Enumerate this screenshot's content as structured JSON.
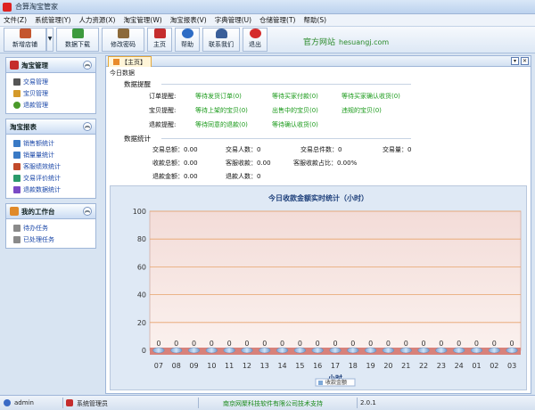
{
  "window": {
    "title": "合算淘宝管家"
  },
  "menu": [
    "文件(Z)",
    "系统管理(Y)",
    "人力资源(X)",
    "淘宝管理(W)",
    "淘宝报表(V)",
    "字典管理(U)",
    "仓储管理(T)",
    "帮助(S)"
  ],
  "toolbar": {
    "buttons": [
      {
        "label": "新增店铺",
        "icon": "store-add-icon",
        "color": "#c4562e"
      },
      {
        "label": "数据下载",
        "icon": "download-icon",
        "color": "#3d9a3d"
      },
      {
        "label": "修改密码",
        "icon": "key-icon",
        "color": "#8c6a3a"
      },
      {
        "label": "主页",
        "icon": "home-icon",
        "color": "#c52d2d"
      },
      {
        "label": "帮助",
        "icon": "help-icon",
        "color": "#2d6cc5"
      },
      {
        "label": "联系我们",
        "icon": "contact-icon",
        "color": "#3a5f9a"
      },
      {
        "label": "退出",
        "icon": "power-icon",
        "color": "#d42b2b"
      }
    ],
    "official_label": "官方网站",
    "official_url": "hesuangj.com"
  },
  "sidebar": {
    "panels": [
      {
        "title": "淘宝管理",
        "items": [
          "交易管理",
          "宝贝管理",
          "退款管理"
        ]
      },
      {
        "title": "淘宝报表",
        "items": [
          "销售额统计",
          "销量量统计",
          "客服绩效统计",
          "交易评价统计",
          "退款数据统计"
        ]
      },
      {
        "title": "我的工作台",
        "items": [
          "待办任务",
          "已处理任务"
        ]
      }
    ]
  },
  "main": {
    "tab_label": "【主页】",
    "today_label": "今日数据",
    "reminders": {
      "header": "数据提醒",
      "order_label": "订单提醒:",
      "order_links": [
        "等待发货订单(0)",
        "等待买家付款(0)",
        "等待买家确认收货(0)"
      ],
      "item_label": "宝贝提醒:",
      "item_links": [
        "等待上架的宝贝(0)",
        "出售中的宝贝(0)",
        "违规的宝贝(0)"
      ],
      "refund_label": "退款提醒:",
      "refund_links": [
        "等待同意的退款(0)",
        "等待确认收货(0)"
      ]
    },
    "stats": {
      "header": "数据统计",
      "rows": [
        [
          "交易总额：0.00",
          "交易人数：0",
          "交易总件数：0",
          "交易量：0"
        ],
        [
          "收款总额：0.00",
          "客服收款：0.00",
          "客服收款占比：0.00%"
        ],
        [
          "退款金额：0.00",
          "退款人数：0"
        ]
      ]
    }
  },
  "chart_data": {
    "type": "bar",
    "title": "今日收款金额实时统计（小时）",
    "xlabel": "小时",
    "ylabel": "",
    "categories": [
      "07",
      "08",
      "09",
      "10",
      "11",
      "12",
      "13",
      "14",
      "15",
      "16",
      "17",
      "18",
      "19",
      "20",
      "21",
      "22",
      "23",
      "24",
      "01",
      "02",
      "03"
    ],
    "yticks": [
      0,
      20,
      40,
      60,
      80,
      100
    ],
    "ylim": [
      0,
      100
    ],
    "series": [
      {
        "name": "收款金额",
        "values": [
          0,
          0,
          0,
          0,
          0,
          0,
          0,
          0,
          0,
          0,
          0,
          0,
          0,
          0,
          0,
          0,
          0,
          0,
          0,
          0,
          0
        ]
      }
    ],
    "grid": true,
    "legend": "bottom-center"
  },
  "status": {
    "user": "admin",
    "role": "系统管理员",
    "company": "南京网聚科技软件有限公司技术支持",
    "version": "2.0.1"
  }
}
